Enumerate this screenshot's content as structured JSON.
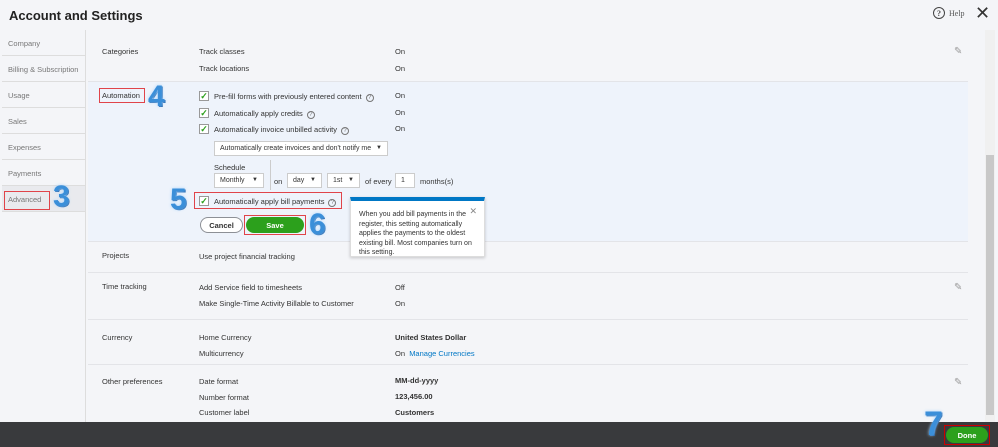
{
  "header": {
    "title": "Account and Settings",
    "help_label": "Help"
  },
  "sidebar": {
    "items": [
      {
        "label": "Company"
      },
      {
        "label": "Billing & Subscription"
      },
      {
        "label": "Usage"
      },
      {
        "label": "Sales"
      },
      {
        "label": "Expenses"
      },
      {
        "label": "Payments"
      },
      {
        "label": "Advanced"
      }
    ]
  },
  "sections": {
    "categories": {
      "label": "Categories",
      "items": [
        {
          "label": "Track classes",
          "value": "On"
        },
        {
          "label": "Track locations",
          "value": "On"
        }
      ]
    },
    "automation": {
      "label": "Automation",
      "items": [
        {
          "label": "Pre-fill forms with previously entered content",
          "value": "On",
          "checked": true
        },
        {
          "label": "Automatically apply credits",
          "value": "On",
          "checked": true
        },
        {
          "label": "Automatically invoice unbilled activity",
          "value": "On",
          "checked": true
        }
      ],
      "invoice_mode": "Automatically create invoices and don't notify me",
      "schedule_label": "Schedule",
      "schedule": "Monthly",
      "on_label": "on",
      "day": "day",
      "nth": "1st",
      "of_every_label": "of every",
      "every_value": "1",
      "months_label": "months(s)",
      "bill_payments_label": "Automatically apply bill payments",
      "bill_payments_checked": true,
      "cancel_label": "Cancel",
      "save_label": "Save",
      "tooltip": "When you add bill payments in the register, this setting automatically applies the payments to the oldest existing bill. Most companies turn on this setting."
    },
    "projects": {
      "label": "Projects",
      "items": [
        {
          "label": "Use project financial tracking"
        }
      ]
    },
    "time_tracking": {
      "label": "Time tracking",
      "items": [
        {
          "label": "Add Service field to timesheets",
          "value": "Off"
        },
        {
          "label": "Make Single-Time Activity Billable to Customer",
          "value": "On"
        }
      ]
    },
    "currency": {
      "label": "Currency",
      "items": [
        {
          "label": "Home Currency",
          "value": "United States Dollar"
        },
        {
          "label": "Multicurrency",
          "value": "On",
          "link": "Manage Currencies"
        }
      ]
    },
    "other": {
      "label": "Other preferences",
      "items": [
        {
          "label": "Date format",
          "value": "MM-dd-yyyy"
        },
        {
          "label": "Number format",
          "value": "123,456.00"
        },
        {
          "label": "Customer label",
          "value": "Customers"
        }
      ]
    }
  },
  "annotations": {
    "step3": "3",
    "step4": "4",
    "step5": "5",
    "step6": "6",
    "step7": "7"
  },
  "footer": {
    "done_label": "Done"
  },
  "colors": {
    "accent_green": "#2ca01c",
    "link_blue": "#0077c5",
    "annotation_red": "#e0444a",
    "footer": "#393a3d"
  }
}
